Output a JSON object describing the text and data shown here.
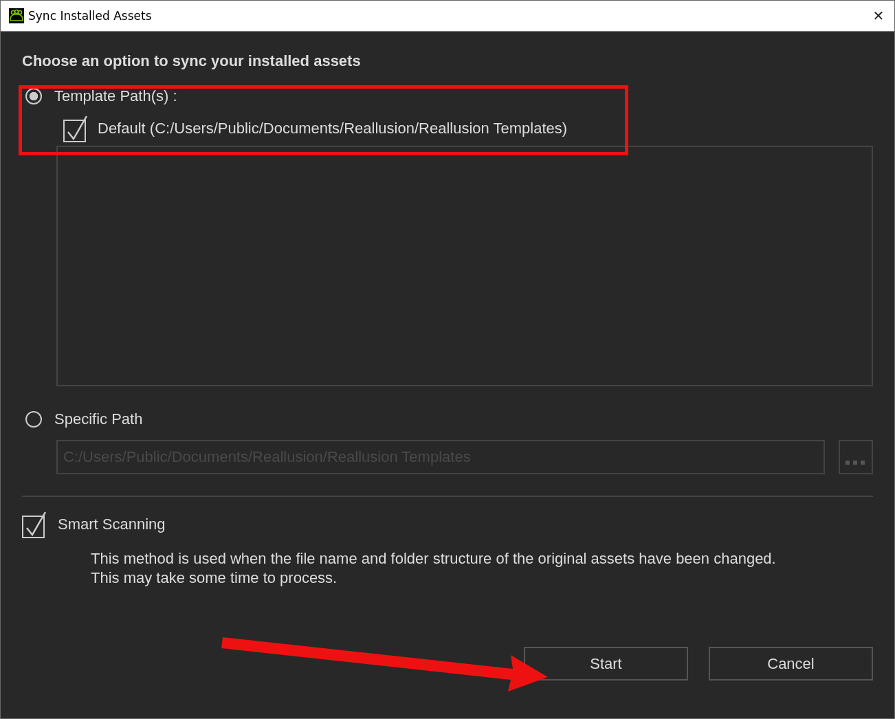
{
  "window": {
    "title": "Sync Installed Assets",
    "close": "✕"
  },
  "heading": "Choose an option to sync your installed assets",
  "options": [
    {
      "label": "Template Path(s) :",
      "selected": true
    },
    {
      "label": "Specific Path",
      "selected": false
    }
  ],
  "template_paths": [
    {
      "label": "Default (C:/Users/Public/Documents/Reallusion/Reallusion Templates)",
      "checked": true
    }
  ],
  "specific_path": {
    "placeholder": "C:/Users/Public/Documents/Reallusion/Reallusion Templates",
    "disabled": true
  },
  "smart_scanning": {
    "label": "Smart Scanning",
    "checked": true,
    "description": [
      "This method is used when the file name and folder structure of the original assets have been changed.",
      "This may take some time to process."
    ]
  },
  "buttons": [
    "Start",
    "Cancel"
  ]
}
